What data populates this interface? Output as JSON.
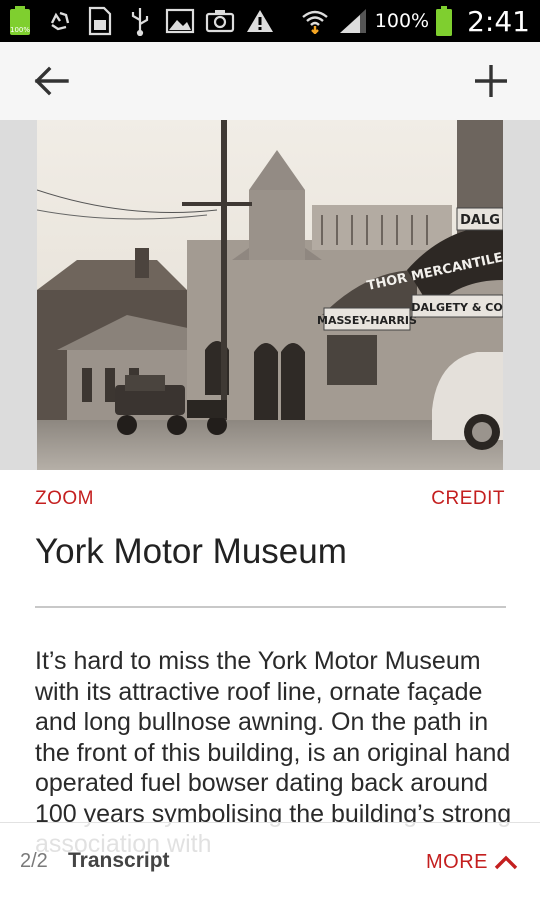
{
  "status_bar": {
    "battery_percent": "100%",
    "time": "2:41",
    "icons": [
      "battery-full-icon",
      "recycle-icon",
      "sd-card-icon",
      "usb-icon",
      "image-icon",
      "camera-icon",
      "warning-icon",
      "wifi-icon",
      "signal-icon",
      "battery-icon"
    ],
    "mini_battery_label": "100%"
  },
  "toolbar": {
    "back_icon": "arrow-left-icon",
    "add_icon": "plus-icon"
  },
  "photo": {
    "alt": "Historic photograph of York Motor Museum building",
    "sign_left": "MASSEY-HARRIS",
    "sign_right_top": "DALG",
    "sign_arch": "THOR MERCANTILE AGENT",
    "sign_right": "DALGETY & CO"
  },
  "links": {
    "zoom": "ZOOM",
    "credit": "CREDIT"
  },
  "title": "York Motor Museum",
  "body": "It’s hard to miss the York Motor Museum with its attractive roof line, ornate façade and long bullnose awning. On the path in the front of this building, is an original hand operated fuel bowser dating back around 100 years symbolising the building’s strong association with",
  "bottom_bar": {
    "page": "2/2",
    "label": "Transcript",
    "more": "MORE"
  },
  "colors": {
    "accent": "#c41f1f",
    "toolbar_bg": "#f6f6f6",
    "status_bg": "#000000"
  }
}
